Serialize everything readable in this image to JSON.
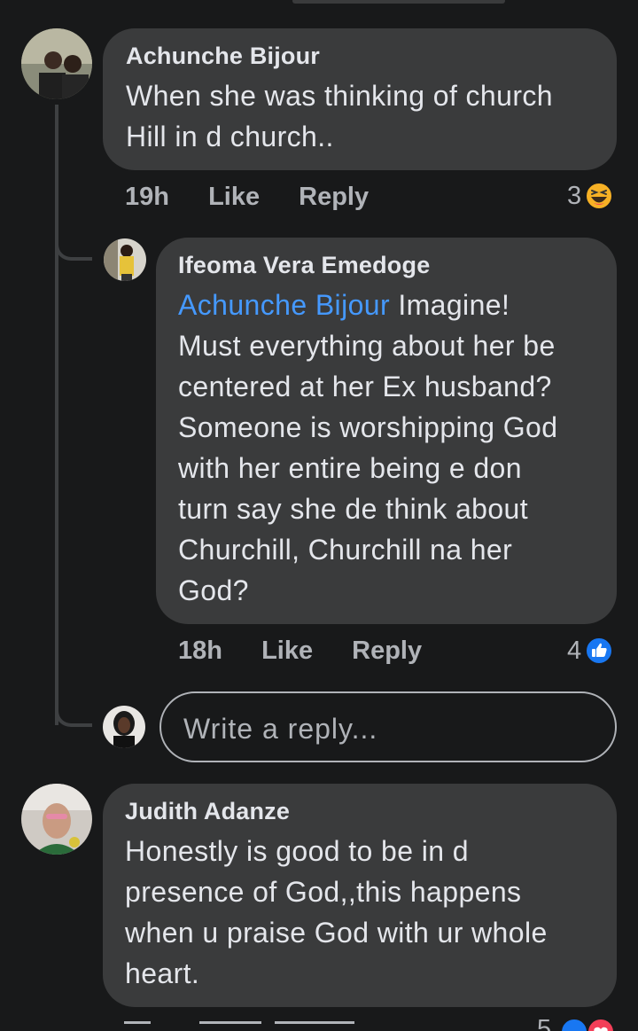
{
  "comments": [
    {
      "author": "Achunche Bijour",
      "lines": [
        "When she was thinking of church",
        "Hill in d church.."
      ],
      "time": "19h",
      "like_label": "Like",
      "reply_label": "Reply",
      "reaction_count": "3",
      "reaction_icon": "haha-emoji-icon"
    },
    {
      "author": "Ifeoma Vera Emedoge",
      "mention": "Achunche Bijour",
      "first_line_rest": " Imagine!",
      "lines": [
        "Must everything about her be",
        "centered at her Ex husband?",
        "Someone is worshipping God",
        "with her entire being e don",
        "turn say she de think about",
        "Churchill, Churchill na her",
        "God?"
      ],
      "time": "18h",
      "like_label": "Like",
      "reply_label": "Reply",
      "reaction_count": "4",
      "reaction_icon": "like-thumb-icon"
    },
    {
      "author": "Judith Adanze",
      "lines": [
        "Honestly is good to be in d",
        "presence of God,,this happens",
        "when u praise God with ur whole",
        "heart."
      ],
      "time": "",
      "reaction_count": "5",
      "reaction_icon": "like-love-icons"
    }
  ],
  "reply_input": {
    "placeholder": "Write a reply..."
  },
  "colors": {
    "background": "#18191a",
    "bubble": "#3a3b3c",
    "mention": "#4599ff",
    "like_blue": "#1877f2",
    "haha_yellow": "#f7b125",
    "love_red": "#f33e58"
  }
}
